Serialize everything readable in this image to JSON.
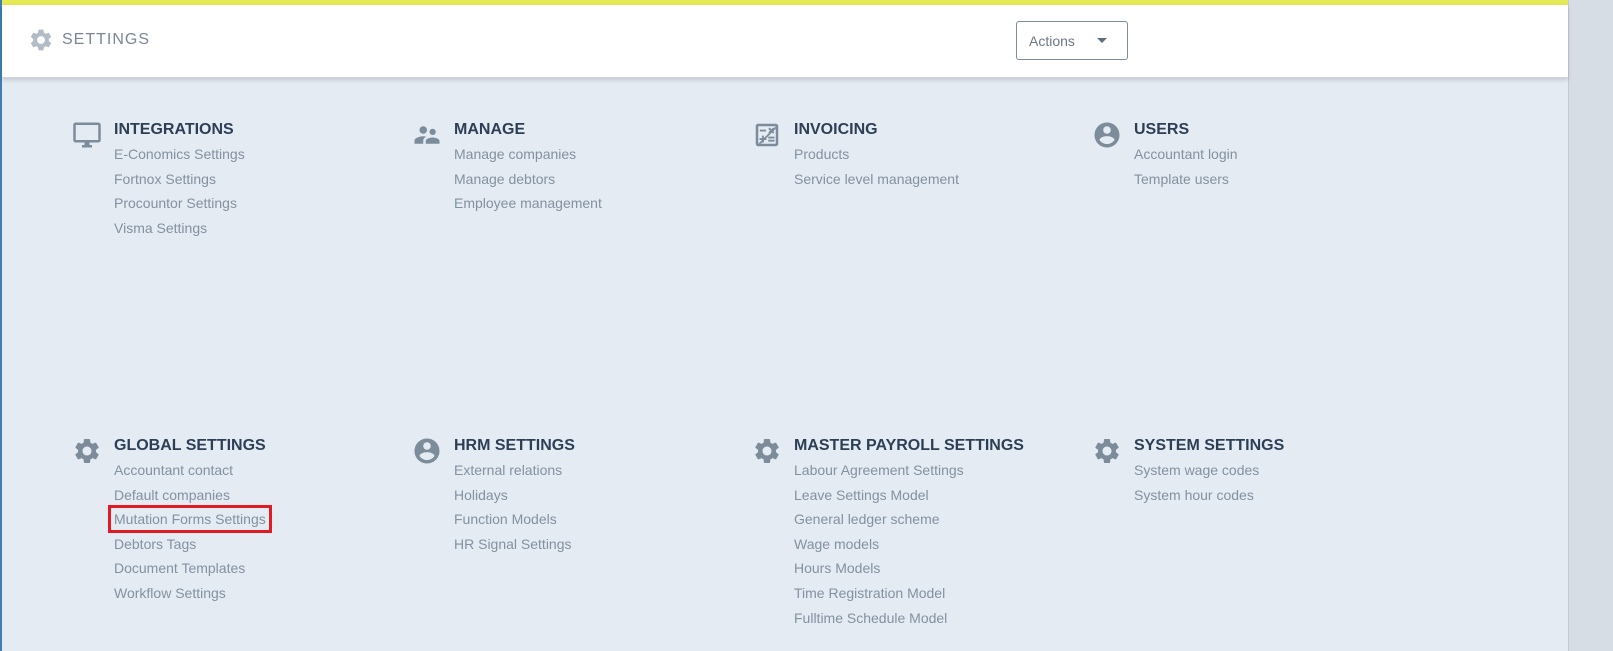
{
  "header": {
    "title": "SETTINGS",
    "actions_label": "Actions"
  },
  "sections": [
    {
      "title": "INTEGRATIONS",
      "icon": "monitor-icon",
      "items": [
        "E-Conomics Settings",
        "Fortnox Settings",
        "Procountor Settings",
        "Visma Settings"
      ]
    },
    {
      "title": "MANAGE",
      "icon": "people-icon",
      "items": [
        "Manage companies",
        "Manage debtors",
        "Employee management"
      ]
    },
    {
      "title": "INVOICING",
      "icon": "invoice-icon",
      "items": [
        "Products",
        "Service level management"
      ]
    },
    {
      "title": "USERS",
      "icon": "user-circle-icon",
      "items": [
        "Accountant login",
        "Template users"
      ]
    },
    {
      "title": "GLOBAL SETTINGS",
      "icon": "gear-icon",
      "items": [
        "Accountant contact",
        "Default companies",
        "Mutation Forms Settings",
        "Debtors Tags",
        "Document Templates",
        "Workflow Settings"
      ]
    },
    {
      "title": "HRM SETTINGS",
      "icon": "user-circle-icon",
      "items": [
        "External relations",
        "Holidays",
        "Function Models",
        "HR Signal Settings"
      ]
    },
    {
      "title": "MASTER PAYROLL SETTINGS",
      "icon": "gear-icon",
      "items": [
        "Labour Agreement Settings",
        "Leave Settings Model",
        "General ledger scheme",
        "Wage models",
        "Hours Models",
        "Time Registration Model",
        "Fulltime Schedule Model"
      ]
    },
    {
      "title": "SYSTEM SETTINGS",
      "icon": "gear-icon",
      "items": [
        "System wage codes",
        "System hour codes"
      ]
    }
  ],
  "colors": {
    "background": "#e4ebf3",
    "title": "#2c3f55",
    "link": "#8391a0",
    "highlight": "#e01b22"
  }
}
